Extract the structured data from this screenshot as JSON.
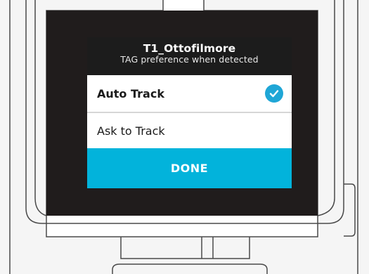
{
  "dialog": {
    "title": "T1_Ottofilmore",
    "subtitle": "TAG preference when detected",
    "options": [
      {
        "label": "Auto Track",
        "selected": true,
        "icon": "check-circle-icon"
      },
      {
        "label": "Ask to Track",
        "selected": false
      }
    ],
    "done_label": "DONE"
  },
  "colors": {
    "accent": "#02b3db",
    "check": "#1fa6d6",
    "screen_bg": "#201c1c",
    "header_bg": "#1c1c1c"
  }
}
